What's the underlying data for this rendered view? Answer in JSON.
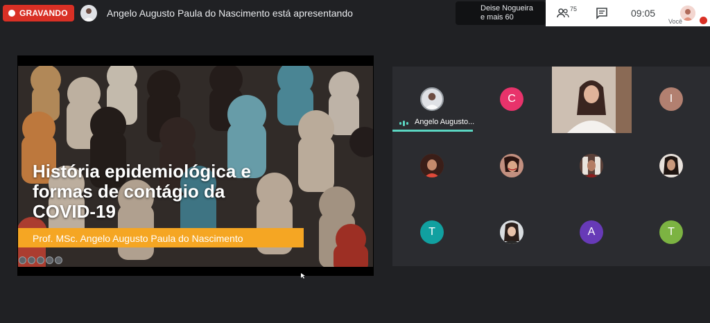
{
  "recording": {
    "label": "GRAVANDO"
  },
  "presenter": {
    "banner": "Angelo Augusto Paula do Nascimento está apresentando"
  },
  "speakers": {
    "line1": "Deise Nogueira",
    "line2": "e mais 60"
  },
  "toolbar": {
    "people_count": "75",
    "time": "09:05",
    "you_label": "Você"
  },
  "slide": {
    "title": "História epidemiológica e formas de contágio da COVID-19",
    "subtitle": "Prof. MSc. Angelo Augusto Paula do Nascimento"
  },
  "participants": [
    {
      "name": "Angelo Augusto...",
      "type": "photo",
      "color": "#3c4043"
    },
    {
      "initial": "C",
      "color": "#e8336b"
    },
    {
      "type": "video"
    },
    {
      "initial": "I",
      "color": "#b28070"
    },
    {
      "type": "photo",
      "color": "#8b4a3a"
    },
    {
      "type": "photo",
      "color": "#6b3a2c"
    },
    {
      "type": "photo",
      "color": "#7a4a3c"
    },
    {
      "type": "photo",
      "color": "#4a3028"
    },
    {
      "initial": "T",
      "color": "#11a0a0"
    },
    {
      "type": "photo",
      "color": "#7a8a98"
    },
    {
      "initial": "A",
      "color": "#673ab7"
    },
    {
      "initial": "T",
      "color": "#7cb342"
    }
  ],
  "colors": {
    "recording": "#d93025",
    "accent": "#5bd6c2",
    "subtitle_bar": "#f5a623"
  }
}
